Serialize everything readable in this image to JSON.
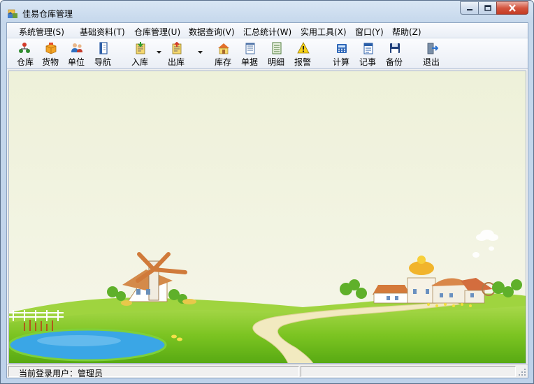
{
  "window": {
    "title": "佳易仓库管理"
  },
  "menu": [
    {
      "label": "系统管理(S)"
    },
    {
      "label": "基础资料(T)"
    },
    {
      "label": "仓库管理(U)"
    },
    {
      "label": "数据查询(V)"
    },
    {
      "label": "汇总统计(W)"
    },
    {
      "label": "实用工具(X)"
    },
    {
      "label": "窗口(Y)"
    },
    {
      "label": "帮助(Z)"
    }
  ],
  "toolbar": [
    {
      "label": "仓库",
      "icon": "warehouse-icon"
    },
    {
      "label": "货物",
      "icon": "goods-box-icon"
    },
    {
      "label": "单位",
      "icon": "people-icon"
    },
    {
      "label": "导航",
      "icon": "navigation-book-icon"
    },
    {
      "label": "入库",
      "icon": "stock-in-icon",
      "dropdown": true
    },
    {
      "label": "出库",
      "icon": "stock-out-icon",
      "dropdown": true
    },
    {
      "label": "库存",
      "icon": "inventory-house-icon"
    },
    {
      "label": "单据",
      "icon": "document-icon"
    },
    {
      "label": "明细",
      "icon": "detail-list-icon"
    },
    {
      "label": "报警",
      "icon": "warning-icon"
    },
    {
      "label": "计算",
      "icon": "calculator-icon"
    },
    {
      "label": "记事",
      "icon": "notepad-icon"
    },
    {
      "label": "备份",
      "icon": "backup-disk-icon"
    },
    {
      "label": "退出",
      "icon": "exit-door-icon"
    }
  ],
  "status": {
    "user_text": "当前登录用户：管理员"
  },
  "colors": {
    "sky": "#f0f4df",
    "grass": "#7cc422",
    "grass_dark": "#4e9e12",
    "pond": "#3aa6e6",
    "path": "#f2eac0"
  }
}
